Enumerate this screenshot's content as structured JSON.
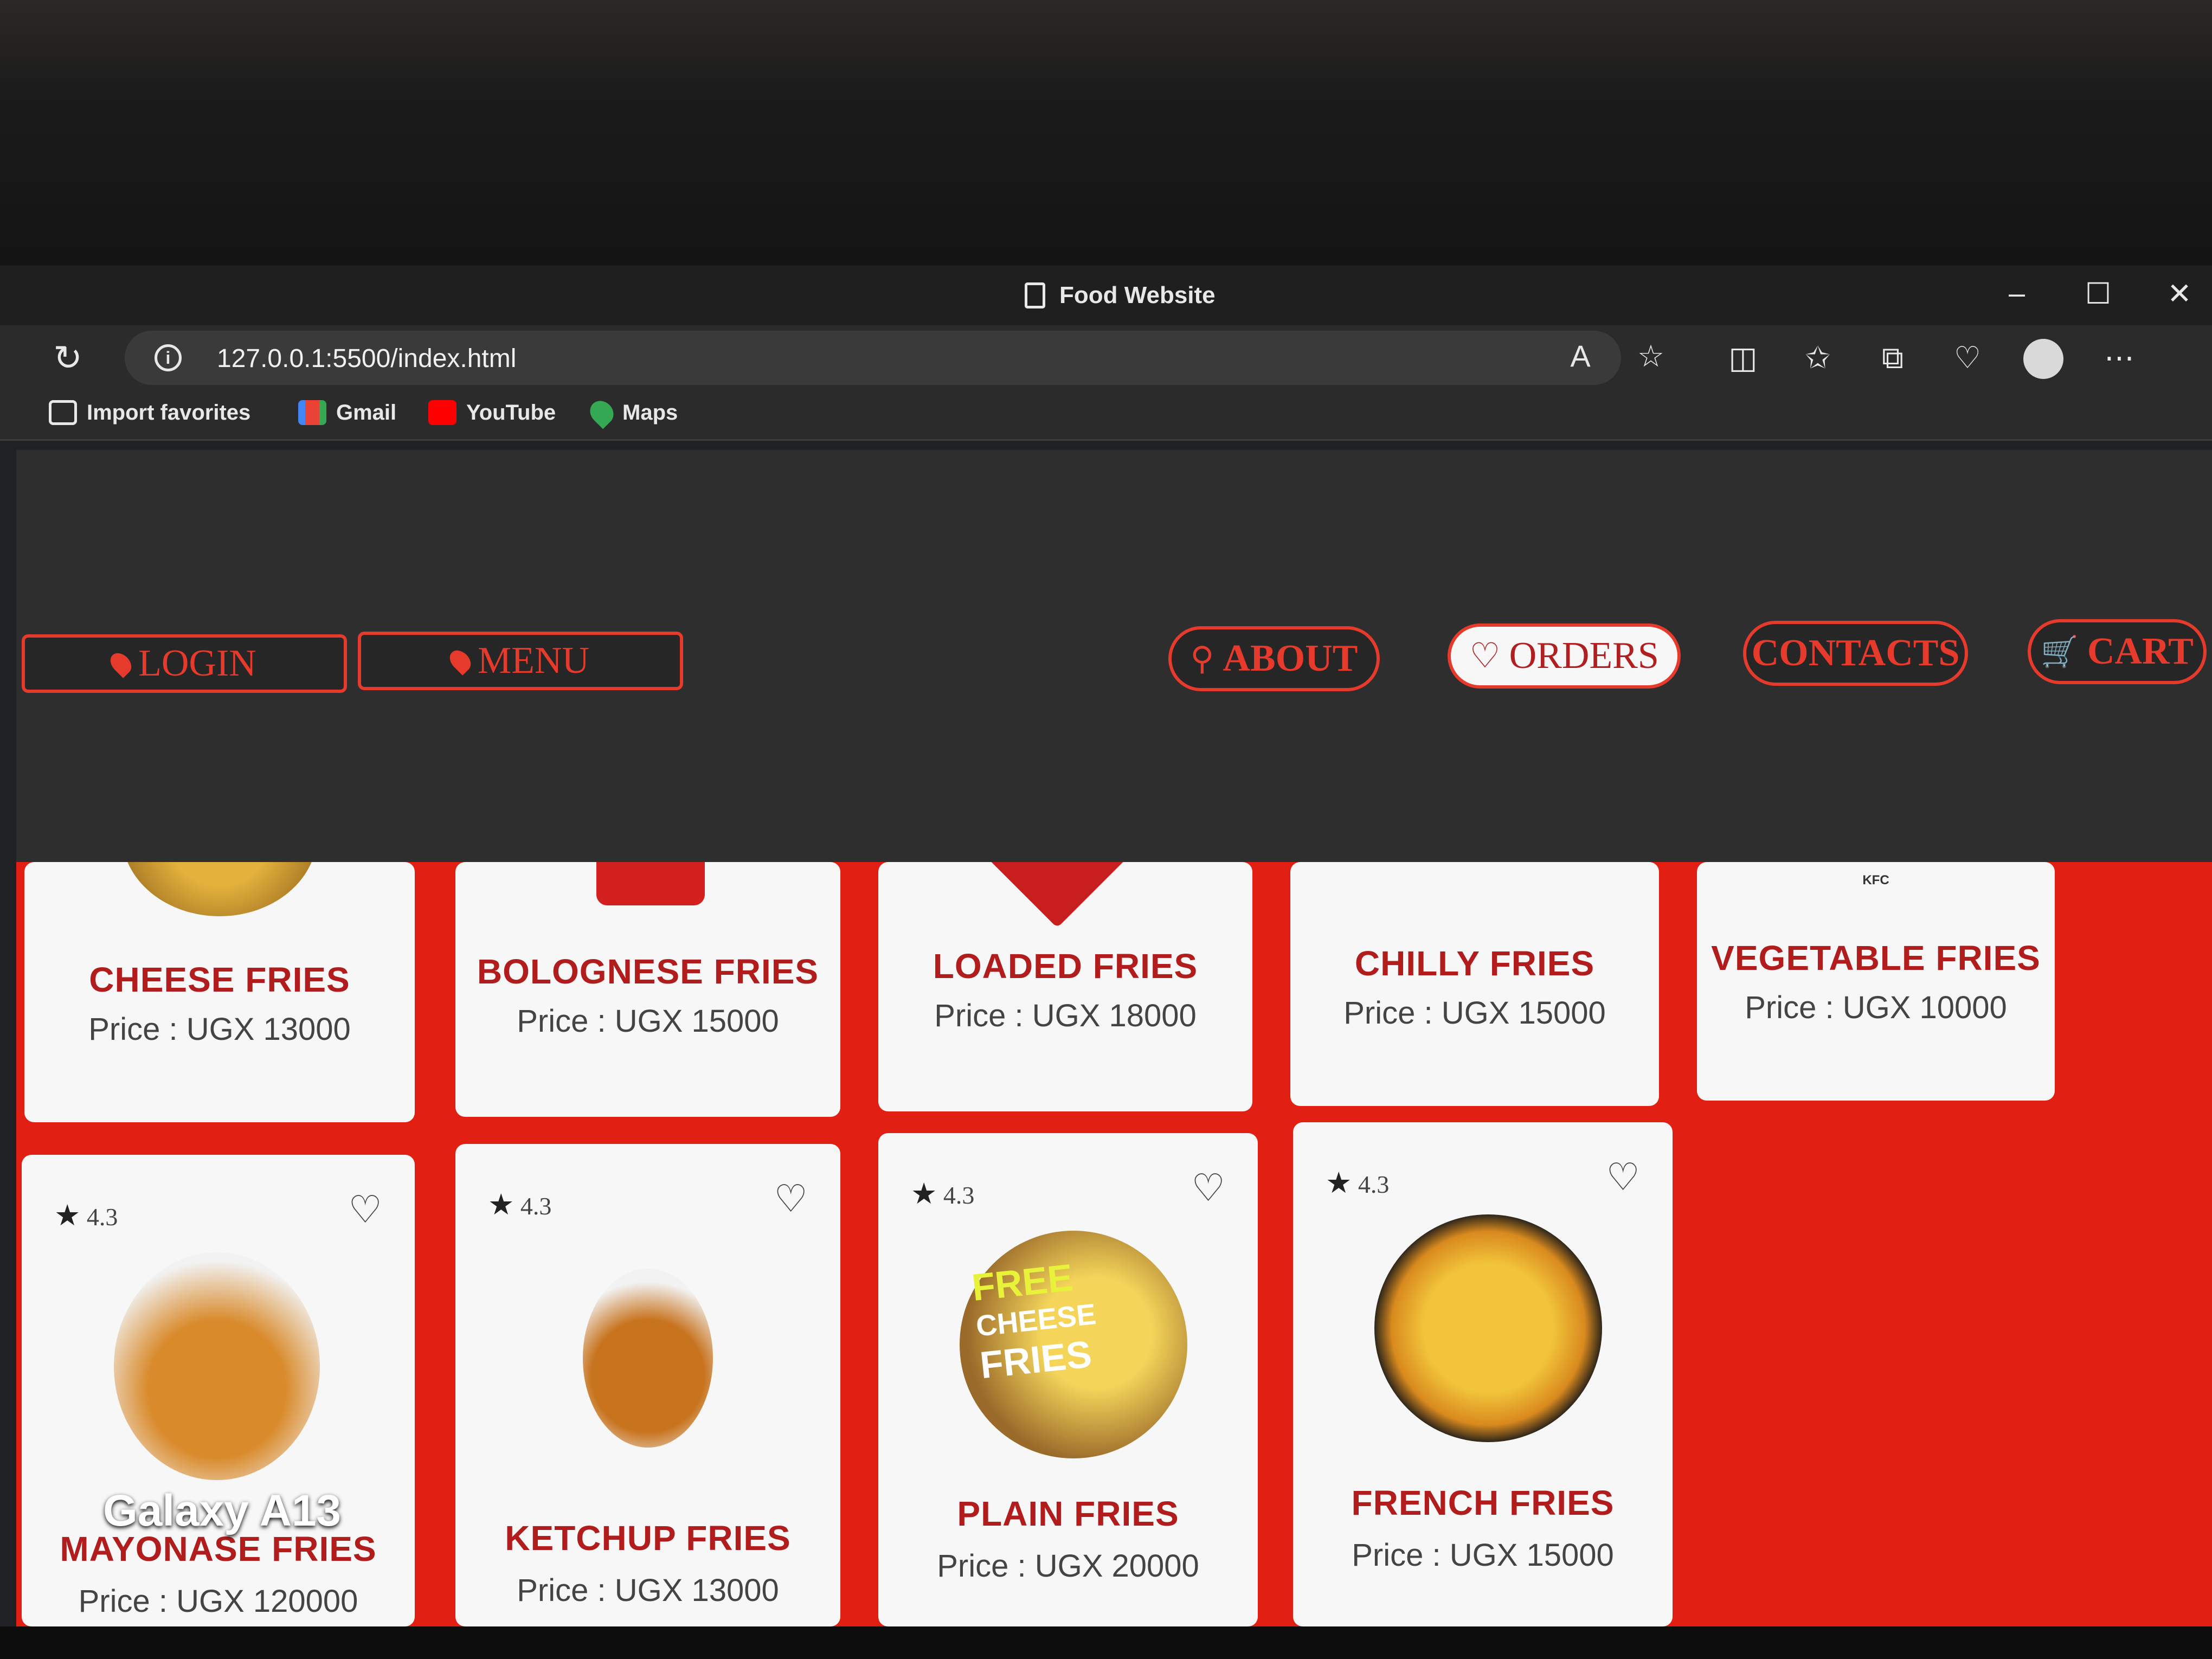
{
  "browser": {
    "window_title": "Food Website",
    "url": "127.0.0.1:5500/index.html",
    "window_controls": [
      "–",
      "☐",
      "✕"
    ],
    "bookmarks": [
      {
        "label": "Import favorites",
        "icon": "folder-import-icon"
      },
      {
        "label": "Gmail",
        "icon": "gmail-icon"
      },
      {
        "label": "YouTube",
        "icon": "youtube-icon"
      },
      {
        "label": "Maps",
        "icon": "maps-icon"
      }
    ]
  },
  "nav": {
    "login": "LOGIN",
    "menu": "MENU",
    "about": "ABOUT",
    "orders": "ORDERS",
    "contacts": "CONTACTS",
    "cart": "CART"
  },
  "menu_top": [
    {
      "name": "CHEESE FRIES",
      "price": "Price : UGX 13000"
    },
    {
      "name": "BOLOGNESE FRIES",
      "price": "Price : UGX 15000"
    },
    {
      "name": "LOADED FRIES",
      "price": "Price : UGX 18000"
    },
    {
      "name": "CHILLY FRIES",
      "price": "Price : UGX 15000"
    },
    {
      "name": "VEGETABLE FRIES",
      "price": "Price : UGX 10000"
    }
  ],
  "menu_bottom": [
    {
      "name": "MAYONASE FRIES",
      "price": "Price : UGX 120000",
      "rating": "4.3"
    },
    {
      "name": "KETCHUP FRIES",
      "price": "Price : UGX 13000",
      "rating": "4.3"
    },
    {
      "name": "PLAIN FRIES",
      "price": "Price : UGX 20000",
      "rating": "4.3"
    },
    {
      "name": "FRENCH FRIES",
      "price": "Price : UGX 15000",
      "rating": "4.3"
    }
  ],
  "image_text": {
    "kfc_label": "KFC",
    "promo_line1": "FREE",
    "promo_line2": "CHEESE",
    "promo_line3": "FRIES"
  },
  "watermark": "Galaxy A13",
  "colors": {
    "accent": "#e53a2c",
    "page_bg": "#2e2e2e",
    "menu_bg": "#e11f12",
    "title_red": "#b11d1d"
  }
}
